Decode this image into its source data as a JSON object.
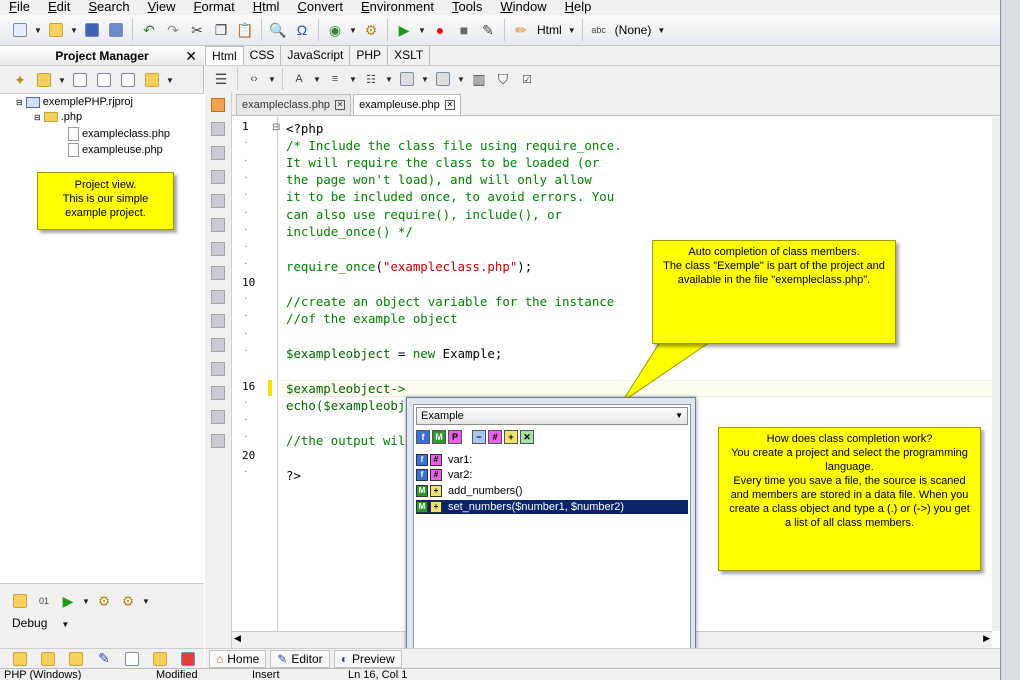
{
  "menu": [
    "File",
    "Edit",
    "Search",
    "View",
    "Format",
    "Html",
    "Convert",
    "Environment",
    "Tools",
    "Window",
    "Help"
  ],
  "toolbar": {
    "language": "Html",
    "none_label": "(None)"
  },
  "project_manager": {
    "title": "Project Manager",
    "close": "✕",
    "tree": {
      "project": "exemplePHP.rjproj",
      "folder": ".php",
      "files": [
        "exampleclass.php",
        "exampleuse.php"
      ]
    },
    "note": "Project view.\nThis is our simple example project.",
    "debug_label": "Debug"
  },
  "editor_tabs": [
    "Html",
    "CSS",
    "JavaScript",
    "PHP",
    "XSLT"
  ],
  "file_tabs": [
    {
      "label": "exampleclass.php",
      "active": false
    },
    {
      "label": "exampleuse.php",
      "active": true
    }
  ],
  "line_numbers": [
    {
      "n": "1",
      "row": 0
    },
    {
      "n": "10",
      "row": 9
    },
    {
      "n": "16",
      "row": 15
    },
    {
      "n": "20",
      "row": 19
    }
  ],
  "code": {
    "l1": "<?php",
    "l2": "/* Include the class file using require_once.",
    "l3": "It will require the class to be loaded (or",
    "l4": "the page won't load), and will only allow",
    "l5": "it to be included once, to avoid errors. You",
    "l6": "can also use require(), include(), or",
    "l7": "include_once() */",
    "l9a": "require_once",
    "l9b": "(",
    "l9c": "\"exampleclass.php\"",
    "l9d": ");",
    "l11": "//create an object variable for the instance",
    "l12": "//of the example object",
    "l14a": "$exampleobject",
    "l14b": " = ",
    "l14c": "new",
    "l14d": " Example;",
    "l16": "$exampleobject->",
    "l17": "echo($exampleobj",
    "l19": "//the output wil",
    "l21": "?>"
  },
  "note_autocomplete": "Auto completion of class members.\nThe class \"Exemple\" is part of the project and available in the file \"exempleclass.php\".",
  "note_how": "How does class completion work?\nYou create a project and select the programming language.\nEvery time you save a file, the source is scaned and members are stored in a data file. When you create a class object and type a (.) or (->) you get a list of all class members.",
  "popup": {
    "class_selected": "Example",
    "items": [
      {
        "badge1": "f",
        "badge2": "#",
        "label": "var1:",
        "selected": false
      },
      {
        "badge1": "f",
        "badge2": "#",
        "label": "var2:",
        "selected": false
      },
      {
        "badge1": "M",
        "badge2": "+",
        "label": "add_numbers()",
        "selected": false
      },
      {
        "badge1": "M",
        "badge2": "+",
        "label": "set_numbers($number1, $number2)",
        "selected": true
      }
    ]
  },
  "bottom_tabs": [
    "Home",
    "Editor",
    "Preview"
  ],
  "status": {
    "mode": "PHP (Windows)",
    "modified": "Modified",
    "insert": "Insert",
    "pos": "Ln 16, Col 1"
  },
  "colors": {
    "note": "#ffff00",
    "selection": "#0a246a",
    "comment": "#008000",
    "string": "#cc0000"
  }
}
